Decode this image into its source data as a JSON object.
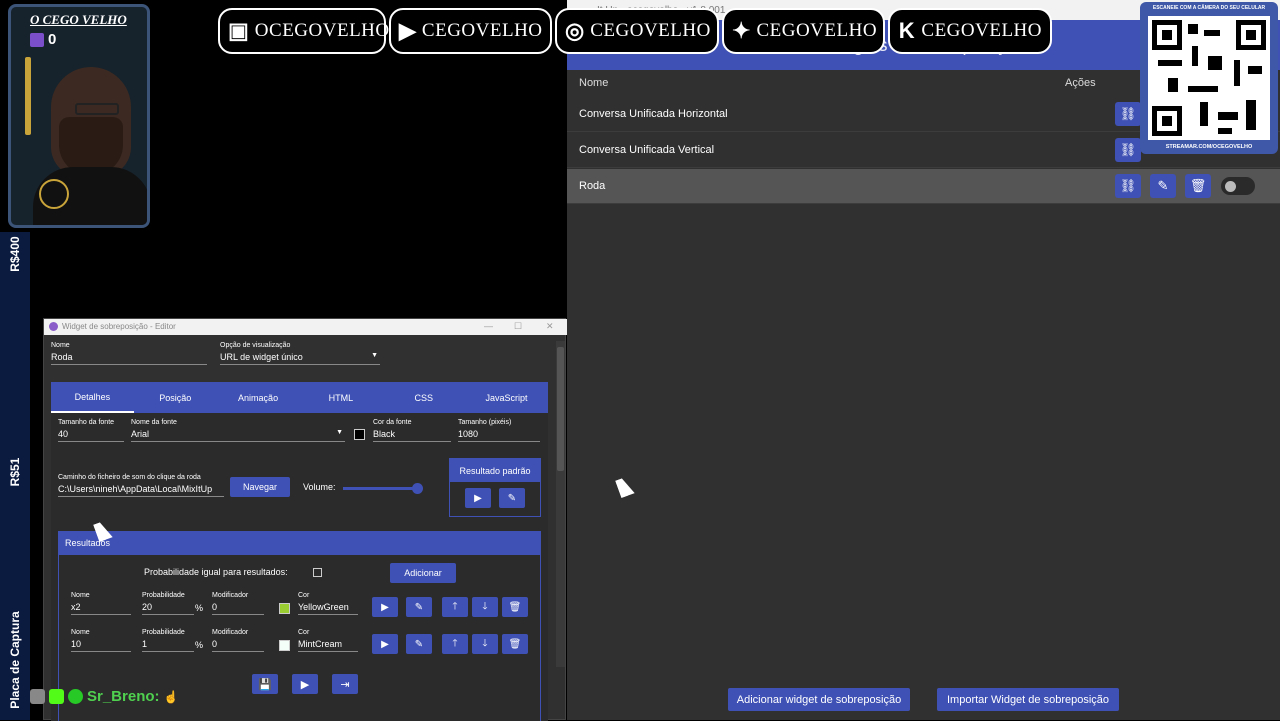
{
  "overlay": {
    "cam_name": "O CEGO VELHO",
    "cam_counter": "0",
    "strip_labels": [
      "R$400",
      "R$51",
      "Placa de Captura"
    ],
    "socials": [
      {
        "icon": "twitch-icon",
        "glyph": "▣",
        "label": "OCEGOVELHO"
      },
      {
        "icon": "youtube-icon",
        "glyph": "▶",
        "label": "CEGOVELHO"
      },
      {
        "icon": "instagram-icon",
        "glyph": "◎",
        "label": "CEGOVELHO"
      },
      {
        "icon": "twitter-icon",
        "glyph": "✦",
        "label": "CEGOVELHO"
      },
      {
        "icon": "kick-icon",
        "glyph": "K",
        "label": "CEGOVELHO"
      }
    ],
    "qr_top_text": "ESCANEIE COM A CÂMERA DO SEU CELULAR",
    "qr_bottom_text": "STREAMAR.COM/OCEGOVELHO",
    "chat_user": "Sr_Breno:",
    "chat_emoji": "☝"
  },
  "app": {
    "title": "It Up - ocegovelho - v1.8.001",
    "header": "Widgets de sobreposição",
    "col_name": "Nome",
    "col_actions": "Ações",
    "rows": [
      {
        "name": "Conversa Unificada Horizontal",
        "selected": false
      },
      {
        "name": "Conversa Unificada Vertical",
        "selected": false
      },
      {
        "name": "Roda",
        "selected": true
      }
    ],
    "add_button": "Adicionar widget de sobreposição",
    "import_button": "Importar Widget de sobreposição"
  },
  "editor": {
    "title": "Widget de sobreposição - Editor",
    "name_label": "Nome",
    "name_value": "Roda",
    "view_label": "Opção de visualização",
    "view_value": "URL de widget único",
    "tabs": [
      "Detalhes",
      "Posição",
      "Animação",
      "HTML",
      "CSS",
      "JavaScript"
    ],
    "active_tab": "Detalhes",
    "font_size_label": "Tamanho da fonte",
    "font_size_value": "40",
    "font_name_label": "Nome da fonte",
    "font_name_value": "Arial",
    "font_color_label": "Cor da fonte",
    "font_color_value": "Black",
    "size_label": "Tamanho (pixéis)",
    "size_value": "1080",
    "sound_label": "Caminho do ficheiro de som do clique da roda",
    "sound_value": "C:\\Users\\nineh\\AppData\\Local\\MixItUp",
    "browse_button": "Navegar",
    "volume_label": "Volume:",
    "volume_level": 0.95,
    "default_result_label": "Resultado padrão",
    "results_header": "Resultados",
    "equal_prob_label": "Probabilidade igual para resultados:",
    "add_button": "Adicionar",
    "result_name_label": "Nome",
    "result_prob_label": "Probabilidade",
    "result_mod_label": "Modificador",
    "result_color_label": "Cor",
    "percent": "%",
    "results": [
      {
        "name": "x2",
        "prob": "20",
        "mod": "0",
        "color_name": "YellowGreen",
        "color": "#9acd32"
      },
      {
        "name": "10",
        "prob": "1",
        "mod": "0",
        "color_name": "MintCream",
        "color": "#f5fffa"
      }
    ]
  }
}
